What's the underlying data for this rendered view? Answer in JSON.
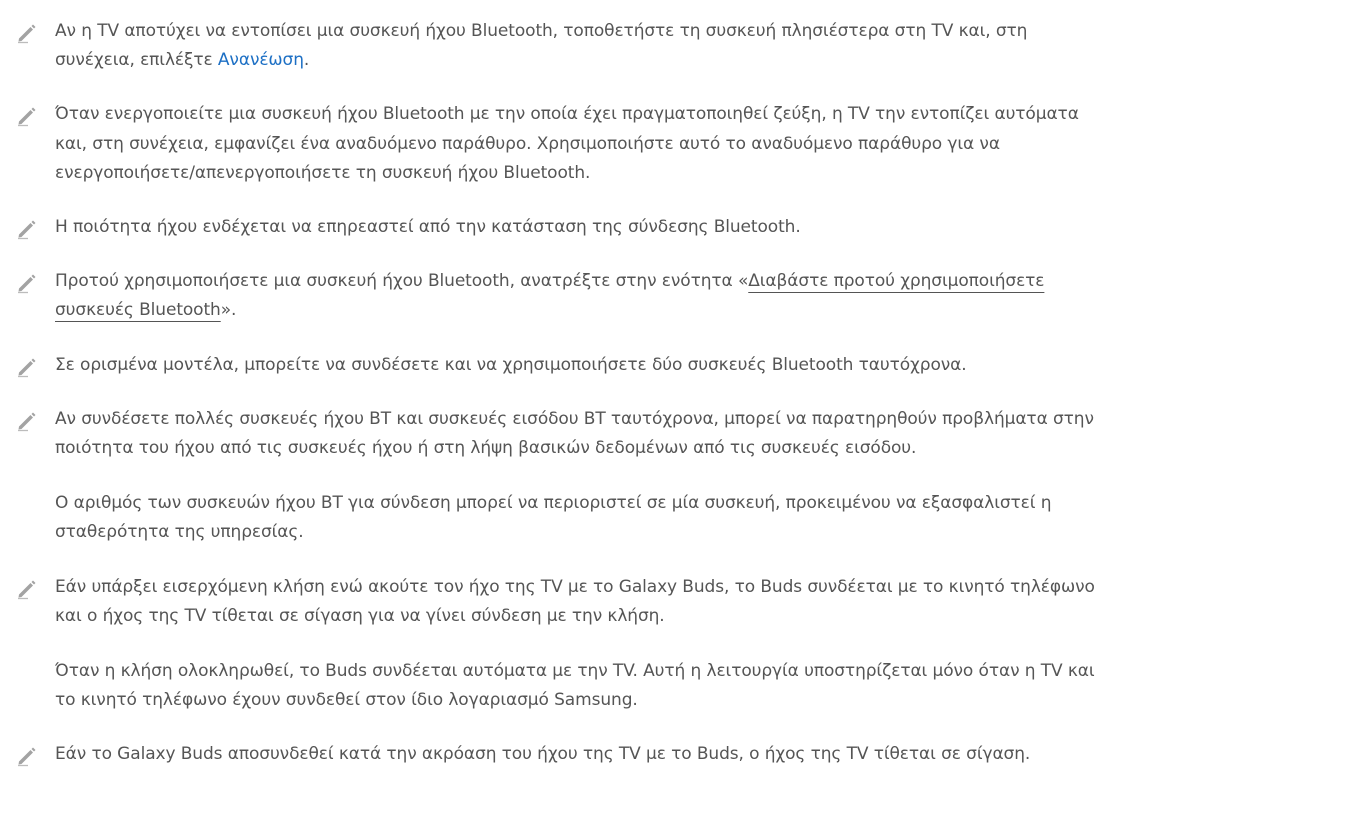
{
  "notes": [
    {
      "l1_before": "Αν η TV αποτύχει να εντοπίσει μια συσκευή ήχου Bluetooth, τοποθετήστε τη συσκευή πλησιέστερα στη TV και, στη",
      "l2_before": "συνέχεια, επιλέξτε ",
      "l2_accent": "Ανανέωση",
      "l2_after": "."
    },
    {
      "l1": "Όταν ενεργοποιείτε μια συσκευή ήχου Bluetooth με την οποία έχει πραγματοποιηθεί ζεύξη, η TV την εντοπίζει αυτόματα",
      "l2": "και, στη συνέχεια, εμφανίζει ένα αναδυόμενο παράθυρο. Χρησιμοποιήστε αυτό το αναδυόμενο παράθυρο για να",
      "l3": "ενεργοποιήσετε/απενεργοποιήσετε τη συσκευή ήχου Bluetooth."
    },
    {
      "l1": "Η ποιότητα ήχου ενδέχεται να επηρεαστεί από την κατάσταση της σύνδεσης Bluetooth."
    },
    {
      "l1_before": "Προτού χρησιμοποιήσετε μια συσκευή ήχου Bluetooth, ανατρέξτε στην ενότητα «",
      "l1_link": "Διαβάστε προτού χρησιμοποιήσετε",
      "l2_link": "συσκευές Bluetooth",
      "l2_after": "»."
    },
    {
      "l1": "Σε ορισμένα μοντέλα, μπορείτε να συνδέσετε και να χρησιμοποιήσετε δύο συσκευές Bluetooth ταυτόχρονα."
    },
    {
      "l1": "Αν συνδέσετε πολλές συσκευές ήχου BT και συσκευές εισόδου BT ταυτόχρονα, μπορεί να παρατηρηθούν προβλήματα στην",
      "l2": "ποιότητα του ήχου από τις συσκευές ήχου ή στη λήψη βασικών δεδομένων από τις συσκευές εισόδου.",
      "p2_l1": "Ο αριθμός των συσκευών ήχου BT για σύνδεση μπορεί να περιοριστεί σε μία συσκευή, προκειμένου να εξασφαλιστεί η",
      "p2_l2": "σταθερότητα της υπηρεσίας."
    },
    {
      "l1": "Εάν υπάρξει εισερχόμενη κλήση ενώ ακούτε τον ήχο της TV με το Galaxy Buds, το Buds συνδέεται με το κινητό τηλέφωνο",
      "l2": "και ο ήχος της TV τίθεται σε σίγαση για να γίνει σύνδεση με την κλήση.",
      "p2_l1": "Όταν η κλήση ολοκληρωθεί, το Buds συνδέεται αυτόματα με την TV. Αυτή η λειτουργία υποστηρίζεται μόνο όταν η TV και",
      "p2_l2": "το κινητό τηλέφωνο έχουν συνδεθεί στον ίδιο λογαριασμό Samsung."
    },
    {
      "l1": "Εάν το Galaxy Buds αποσυνδεθεί κατά την ακρόαση του ήχου της TV με το Buds, ο ήχος της TV τίθεται σε σίγαση."
    }
  ],
  "icon": "pencil-note-icon",
  "colors": {
    "text": "#555555",
    "accent": "#1c6fc4",
    "icon": "#9a9a9a"
  }
}
